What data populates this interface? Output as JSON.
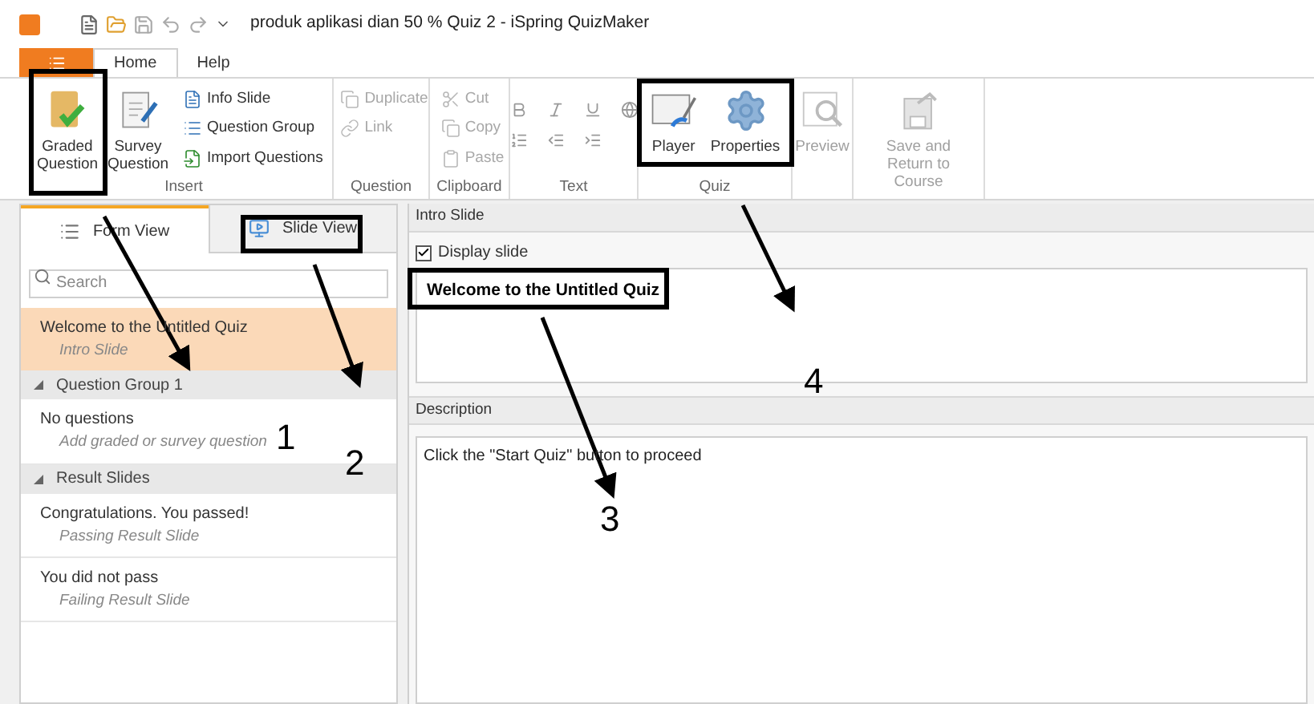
{
  "window": {
    "title": "produk aplikasi dian 50 % Quiz 2 - iSpring QuizMaker"
  },
  "menu_tabs": [
    {
      "label": "Home",
      "selected": true
    },
    {
      "label": "Help",
      "selected": false
    }
  ],
  "ribbon": [
    {
      "label": "Insert",
      "kind": "buttons",
      "large": [
        {
          "label": "Graded Question",
          "kind": "graded"
        },
        {
          "label": "Survey Question",
          "kind": "survey"
        }
      ],
      "small": [
        {
          "label": "Info Slide",
          "kind": "info",
          "disabled": false
        },
        {
          "label": "Question Group",
          "kind": "group",
          "disabled": false
        },
        {
          "label": "Import Questions",
          "kind": "import",
          "disabled": false
        }
      ]
    },
    {
      "label": "Question",
      "kind": "buttons",
      "small": [
        {
          "label": "Duplicate",
          "kind": "duplicate",
          "disabled": true
        },
        {
          "label": "Link",
          "kind": "link",
          "disabled": true
        }
      ]
    },
    {
      "label": "Clipboard",
      "kind": "buttons",
      "small": [
        {
          "label": "Cut",
          "kind": "cut",
          "disabled": true
        },
        {
          "label": "Copy",
          "kind": "copy",
          "disabled": true
        },
        {
          "label": "Paste",
          "kind": "paste",
          "disabled": true
        }
      ]
    },
    {
      "label": "Text",
      "kind": "format"
    },
    {
      "label": "Quiz",
      "kind": "buttons",
      "large": [
        {
          "label": "Player",
          "kind": "player",
          "disabled": false
        },
        {
          "label": "Properties",
          "kind": "properties",
          "disabled": false
        }
      ]
    },
    {
      "kind": "buttons",
      "large": [
        {
          "label": "Preview",
          "kind": "preview",
          "disabled": true
        }
      ]
    },
    {
      "kind": "buttons",
      "large": [
        {
          "label": "Save and Return to Course",
          "kind": "save",
          "disabled": true
        }
      ]
    }
  ],
  "view_tabs": [
    {
      "label": "Form View",
      "selected": true
    },
    {
      "label": "Slide View",
      "selected": false
    }
  ],
  "search": {
    "placeholder": "Search"
  },
  "slides": [
    {
      "kind": "slide",
      "title": "Welcome to the Untitled Quiz",
      "subtitle": "Intro Slide",
      "selected": true
    },
    {
      "kind": "group",
      "title": "Question Group 1",
      "expanded": true
    },
    {
      "kind": "slide",
      "title": "No questions",
      "subtitle": "Add graded or survey question",
      "selected": false
    },
    {
      "kind": "group",
      "title": "Result Slides",
      "expanded": true
    },
    {
      "kind": "slide",
      "title": "Congratulations. You passed!",
      "subtitle": "Passing Result Slide",
      "selected": false
    },
    {
      "kind": "slide",
      "title": "You did not pass",
      "subtitle": "Failing Result Slide",
      "selected": false
    }
  ],
  "intro": {
    "header": "Intro Slide",
    "display_label": "Display slide",
    "display_checked": true,
    "title_value": "Welcome to the Untitled Quiz"
  },
  "description": {
    "header": "Description",
    "value": "Click the \"Start Quiz\" button to proceed"
  },
  "annotations": [
    "1",
    "2",
    "3",
    "4"
  ]
}
